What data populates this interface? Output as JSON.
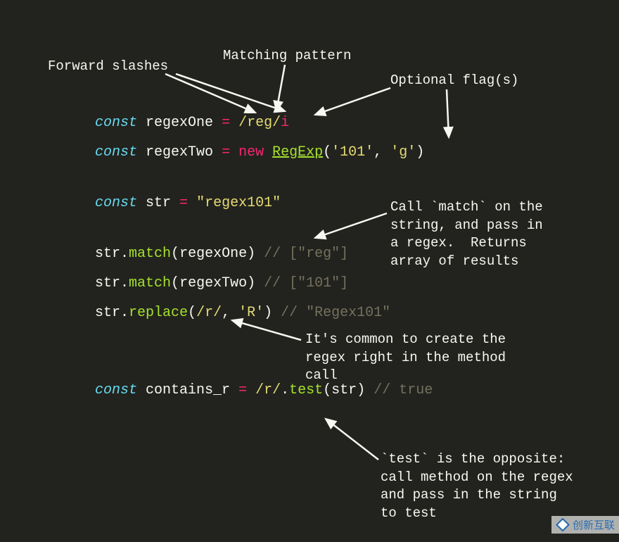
{
  "annotations": {
    "forward_slashes": "Forward slashes",
    "matching_pattern": "Matching pattern",
    "optional_flags": "Optional flag(s)",
    "call_match": "Call `match` on the\nstring, and pass in\na regex.  Returns\narray of results",
    "inline_regex": "It's common to create the\nregex right in the method\ncall",
    "test_opposite": "`test` is the opposite:  \ncall method on the regex \nand pass in the string   \nto test"
  },
  "code": {
    "line1": {
      "const": "const",
      "name": "regexOne",
      "eq": "=",
      "slash1": "/",
      "pattern": "reg",
      "slash2": "/",
      "flag": "i"
    },
    "line2": {
      "const": "const",
      "name": "regexTwo",
      "eq": "=",
      "new": "new",
      "cls": "RegExp",
      "open": "(",
      "arg1": "'101'",
      "comma": ",",
      "arg2": "'g'",
      "close": ")"
    },
    "line3": {
      "const": "const",
      "name": "str",
      "eq": "=",
      "val": "\"regex101\""
    },
    "line4": {
      "obj": "str",
      "dot": ".",
      "method": "match",
      "open": "(",
      "arg": "regexOne",
      "close": ")",
      "comment": "// [\"reg\"]"
    },
    "line5": {
      "obj": "str",
      "dot": ".",
      "method": "match",
      "open": "(",
      "arg": "regexTwo",
      "close": ")",
      "comment": "// [\"101\"]"
    },
    "line6": {
      "obj": "str",
      "dot": ".",
      "method": "replace",
      "open": "(",
      "regex": "/r/",
      "comma": ",",
      "arg2": "'R'",
      "close": ")",
      "comment": "// \"Regex101\""
    },
    "line7": {
      "const": "const",
      "name": "contains_r",
      "eq": "=",
      "regex": "/r/",
      "dot": ".",
      "method": "test",
      "open": "(",
      "arg": "str",
      "close": ")",
      "comment": "// true"
    }
  },
  "watermark": "创新互联"
}
